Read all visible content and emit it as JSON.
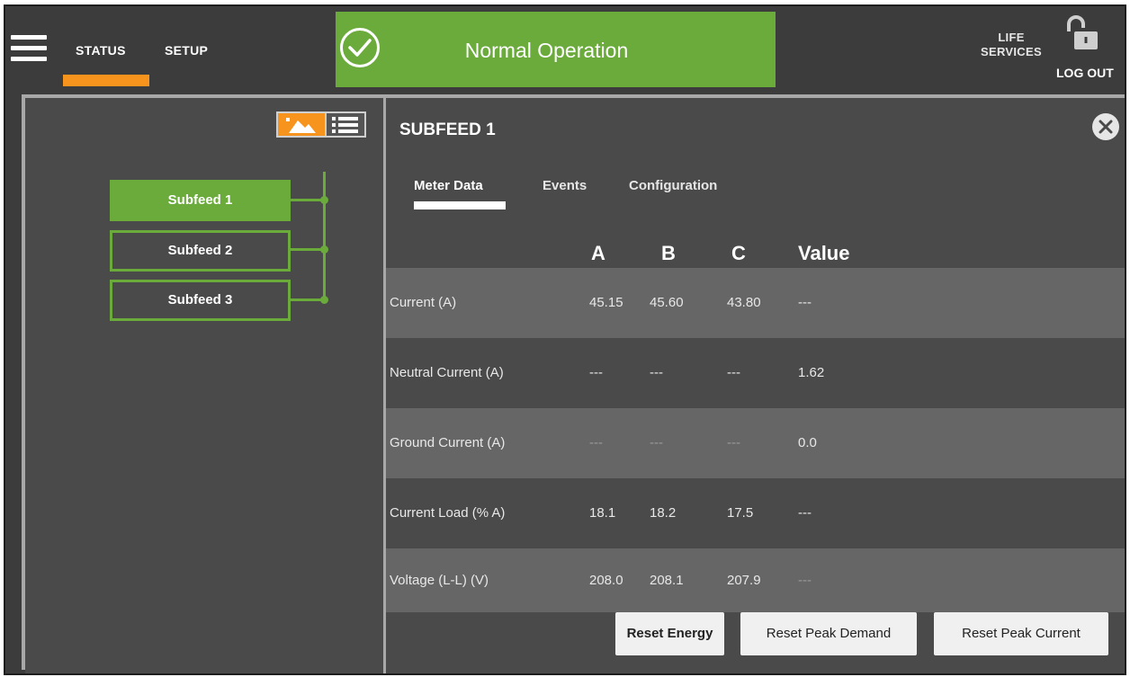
{
  "nav": {
    "status_label": "STATUS",
    "setup_label": "SETUP",
    "life_services_line1": "LIFE",
    "life_services_line2": "SERVICES",
    "logout_label": "LOG OUT"
  },
  "status_banner": {
    "text": "Normal Operation",
    "color": "#6bab3c"
  },
  "left_panel": {
    "view_modes": [
      "map-icon",
      "list-icon"
    ],
    "active_view": "map",
    "subfeeds": [
      {
        "label": "Subfeed 1",
        "active": true
      },
      {
        "label": "Subfeed 2",
        "active": false
      },
      {
        "label": "Subfeed 3",
        "active": false
      }
    ]
  },
  "detail": {
    "title": "SUBFEED 1",
    "tabs": [
      "Meter Data",
      "Events",
      "Configuration"
    ],
    "active_tab": "Meter Data",
    "columns": [
      "A",
      "B",
      "C",
      "Value"
    ],
    "rows": [
      {
        "label": "Current (A)",
        "a": "45.15",
        "b": "45.60",
        "c": "43.80",
        "value": "---"
      },
      {
        "label": "Neutral Current (A)",
        "a": "---",
        "b": "---",
        "c": "---",
        "value": "1.62"
      },
      {
        "label": "Ground Current (A)",
        "a": "---",
        "b": "---",
        "c": "---",
        "value": "0.0"
      },
      {
        "label": "Current Load (% A)",
        "a": "18.1",
        "b": "18.2",
        "c": "17.5",
        "value": "---"
      },
      {
        "label": "Voltage (L-L) (V)",
        "a": "208.0",
        "b": "208.1",
        "c": "207.9",
        "value": "---"
      }
    ],
    "buttons": {
      "reset_energy": "Reset Energy",
      "reset_peak_demand": "Reset Peak Demand",
      "reset_peak_current": "Reset Peak Current"
    }
  },
  "colors": {
    "accent_orange": "#f7941d",
    "accent_green": "#6bab3c",
    "panel_bg": "#4a4a4a",
    "row_light": "#666666"
  }
}
